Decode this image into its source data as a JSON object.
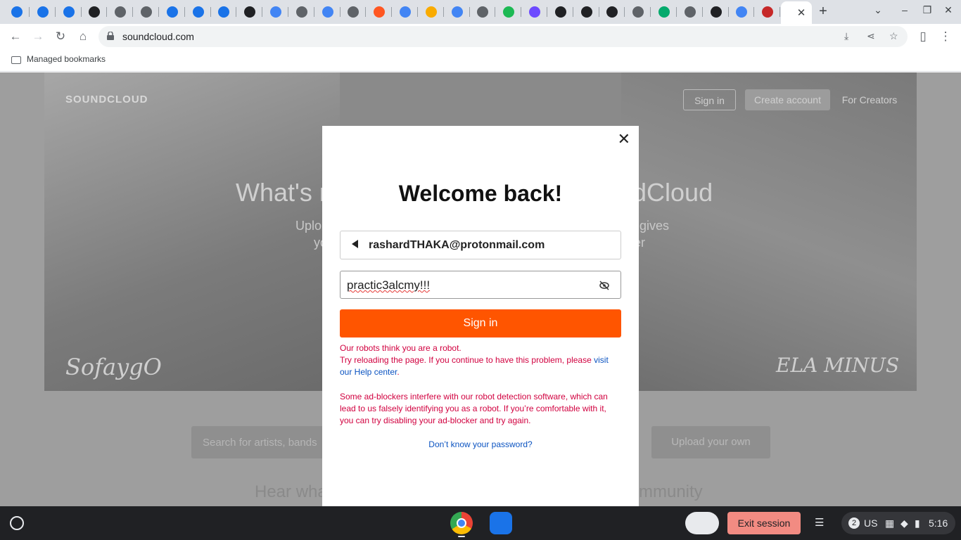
{
  "browser": {
    "tabs": [
      {
        "icon": "loading-icon",
        "color": "#1a73e8"
      },
      {
        "icon": "loading-icon",
        "color": "#1a73e8"
      },
      {
        "icon": "loading-icon",
        "color": "#1a73e8"
      },
      {
        "icon": "github-icon",
        "color": "#202124"
      },
      {
        "icon": "globe-icon",
        "color": "#5f6368"
      },
      {
        "icon": "globe-icon",
        "color": "#5f6368"
      },
      {
        "icon": "loading-icon",
        "color": "#1a73e8"
      },
      {
        "icon": "loading-icon",
        "color": "#1a73e8"
      },
      {
        "icon": "loading-icon",
        "color": "#1a73e8"
      },
      {
        "icon": "unity-icon",
        "color": "#202124"
      },
      {
        "icon": "google-icon",
        "color": "#4285f4"
      },
      {
        "icon": "mascot-icon",
        "color": "#5f6368"
      },
      {
        "icon": "google-icon",
        "color": "#4285f4"
      },
      {
        "icon": "globe-icon",
        "color": "#5f6368"
      },
      {
        "icon": "blogger-icon",
        "color": "#ff5722"
      },
      {
        "icon": "google-icon",
        "color": "#4285f4"
      },
      {
        "icon": "pen-icon",
        "color": "#f9ab00"
      },
      {
        "icon": "google-icon",
        "color": "#4285f4"
      },
      {
        "icon": "globe-icon",
        "color": "#5f6368"
      },
      {
        "icon": "spotify-icon",
        "color": "#1db954"
      },
      {
        "icon": "proton-icon",
        "color": "#6d4aff"
      },
      {
        "icon": "codepen-icon",
        "color": "#202124"
      },
      {
        "icon": "codepen-icon",
        "color": "#202124"
      },
      {
        "icon": "codepen-icon",
        "color": "#202124"
      },
      {
        "icon": "globe-icon",
        "color": "#5f6368"
      },
      {
        "icon": "w3-icon",
        "color": "#04aa6d"
      },
      {
        "icon": "globe-icon",
        "color": "#5f6368"
      },
      {
        "icon": "codesandbox-icon",
        "color": "#202124"
      },
      {
        "icon": "google-icon",
        "color": "#4285f4"
      },
      {
        "icon": "flag-icon",
        "color": "#c62828"
      }
    ],
    "url": "soundcloud.com",
    "bookmarks_label": "Managed bookmarks"
  },
  "background_page": {
    "logo": "SOUNDCLOUD",
    "sign_in": "Sign in",
    "create_account": "Create account",
    "for_creators": "For Creators",
    "hero_title_left": "What's n",
    "hero_title_right": "ndCloud",
    "hero_sub_left_1": "Uplo",
    "hero_sub_left_2": "yo",
    "hero_sub_right_1": "gives",
    "hero_sub_right_2": "er",
    "signature_left": "SofaygO",
    "signature_right": "ELA MINUS",
    "search_placeholder": "Search for artists, bands",
    "upload_btn": "Upload your own",
    "hear_left": "Hear wha",
    "hear_right": "mmunity"
  },
  "modal": {
    "title": "Welcome back!",
    "email": "rashardTHAKA@protonmail.com",
    "password": "practic3alcmy!!!",
    "sign_in_button": "Sign in",
    "error_1": "Our robots think you are a robot.",
    "error_2": "Try reloading the page. If you continue to have this problem, please ",
    "error_link": "visit our Help center",
    "error_2_end": ".",
    "error_3": "Some ad-blockers interfere with our robot detection software, which can lead to us falsely identifying you as a robot. If you’re comfortable with it, you can try disabling your ad-blocker and try again.",
    "forgot": "Don’t know your password?",
    "accent": "#ff5500"
  },
  "shelf": {
    "exit_session": "Exit session",
    "notif_count": "2",
    "ime": "US",
    "time": "5:16"
  }
}
